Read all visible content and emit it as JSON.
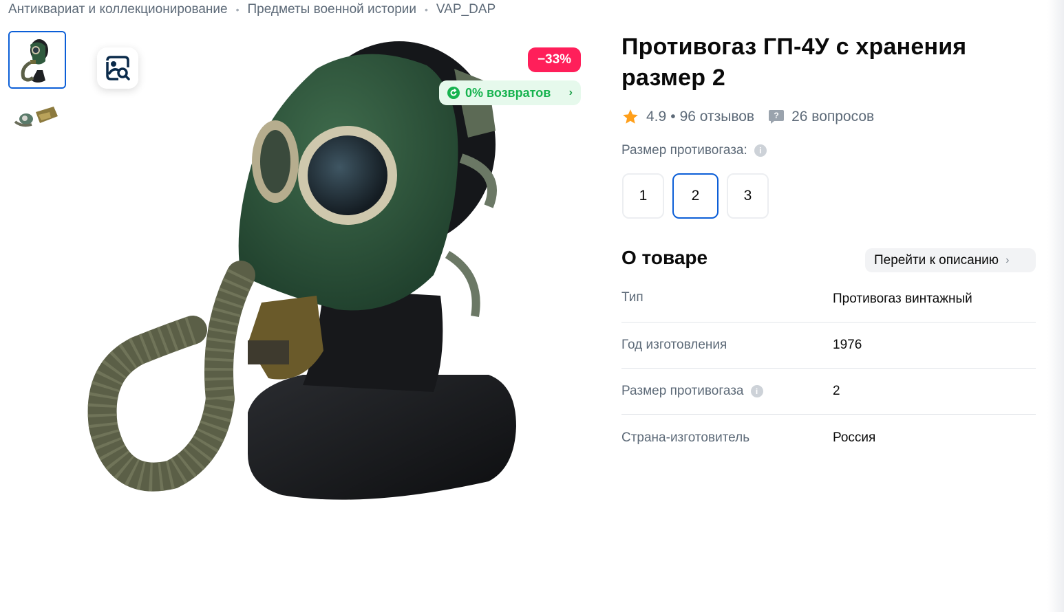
{
  "breadcrumb": {
    "items": [
      "Антиквариат и коллекционирование",
      "Предметы военной истории",
      "VAP_DAP"
    ],
    "separator": "•"
  },
  "gallery": {
    "thumbnails": [
      "thumbnail-1",
      "thumbnail-2"
    ],
    "active_index": 0,
    "lens_icon": "image-search-icon"
  },
  "badges": {
    "discount": "−33%",
    "returns": "0% возвратов"
  },
  "product": {
    "title": "Противогаз ГП-4У с хранения размер 2",
    "rating": "4.9",
    "reviews": "96 отзывов",
    "questions": "26 вопросов"
  },
  "size_selector": {
    "label": "Размер противогаза:",
    "options": [
      "1",
      "2",
      "3"
    ],
    "selected": "2"
  },
  "about": {
    "title": "О товаре",
    "goto_label": "Перейти к описанию",
    "specs": [
      {
        "key": "Тип",
        "value": "Противогаз винтажный"
      },
      {
        "key": "Год изготовления",
        "value": "1976"
      },
      {
        "key": "Размер противогаза",
        "value": "2"
      },
      {
        "key": "Страна-изготовитель",
        "value": "Россия"
      }
    ]
  },
  "colors": {
    "accent": "#0b5ed7",
    "discount_bg": "#ff1f5a",
    "returns_text": "#17b34f",
    "star": "#ff9f1a"
  }
}
